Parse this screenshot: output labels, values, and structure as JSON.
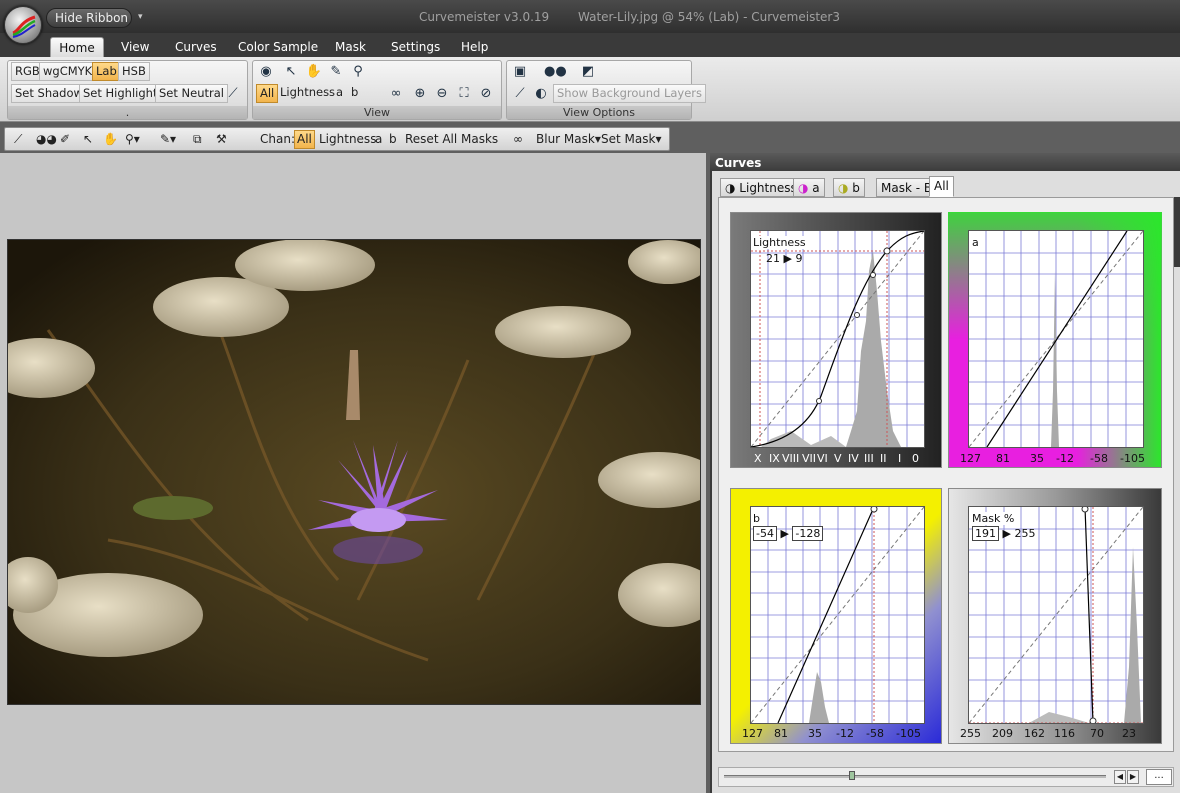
{
  "titlebar": {
    "hide_ribbon_label": "Hide Ribbon",
    "app_name": "Curvemeister v3.0.19",
    "doc_title": "Water-Lily.jpg @ 54% (Lab) - Curvemeister3"
  },
  "menu": {
    "tabs": [
      "Home",
      "View",
      "Curves",
      "Color Sample",
      "Mask",
      "Settings",
      "Help"
    ],
    "active": "Home"
  },
  "ribbon": {
    "mode_buttons": [
      "RGB",
      "wgCMYK",
      "Lab",
      "HSB"
    ],
    "active_mode": "Lab",
    "set_buttons": [
      "Set Shadow",
      "Set Highlight",
      "Set Neutral"
    ],
    "group1_footer": ".",
    "view_channels": [
      "All",
      "Lightness",
      "a",
      "b"
    ],
    "view_active_channel": "All",
    "view_footer": "View",
    "show_background_layers": "Show Background Layers",
    "view_options_footer": "View Options"
  },
  "toolbar2": {
    "chan_label": "Chan:",
    "channels": [
      "All",
      "Lightness",
      "a",
      "b"
    ],
    "active_channel": "All",
    "reset_all_masks": "Reset All Masks",
    "blur_mask": "Blur Mask",
    "set_mask": "Set Mask"
  },
  "curves_panel": {
    "title": "Curves",
    "tabs": [
      "Lightness",
      "a",
      "b",
      "Mask - B",
      "All"
    ],
    "active_tab": "All",
    "lightness": {
      "label": "Lightness",
      "readout_in": "21",
      "readout_out": "9",
      "ticks": [
        "X",
        "IX",
        "VIII",
        "VII",
        "VI",
        "V",
        "IV",
        "III",
        "II",
        "I",
        "0"
      ]
    },
    "a": {
      "label": "a",
      "ticks": [
        "127",
        "81",
        "35",
        "-12",
        "-58",
        "-105"
      ]
    },
    "b": {
      "label": "b",
      "readout_in": "-54",
      "readout_out": "-128",
      "ticks": [
        "127",
        "81",
        "35",
        "-12",
        "-58",
        "-105"
      ]
    },
    "mask": {
      "label": "Mask %",
      "readout_in": "191",
      "readout_out": "255",
      "ticks": [
        "255",
        "209",
        "162",
        "116",
        "70",
        "23"
      ]
    },
    "more_button": "..."
  },
  "colors": {
    "accent": "#f2b44c",
    "curve_grid": "#7b7bd6",
    "a_magenta": "#e81fe0",
    "a_green": "#2ce62c",
    "b_yellow": "#f4f000",
    "b_blue": "#2a2ad8"
  }
}
